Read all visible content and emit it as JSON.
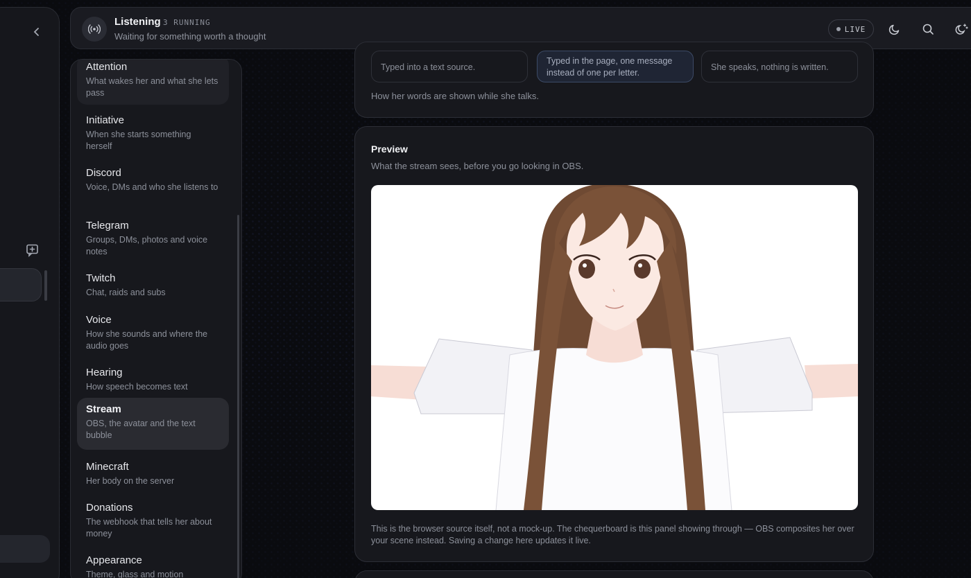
{
  "header": {
    "title": "Listening",
    "running": "3 RUNNING",
    "subtitle": "Waiting for something worth a thought",
    "live_label": "LIVE"
  },
  "sidebar": {
    "items": [
      {
        "title": "Attention",
        "desc": "What wakes her and what she lets pass"
      },
      {
        "title": "Initiative",
        "desc": "When she starts something herself"
      },
      {
        "title": "Discord",
        "desc": "Voice, DMs and who she listens to"
      },
      {
        "title": "Telegram",
        "desc": "Groups, DMs, photos and voice notes"
      },
      {
        "title": "Twitch",
        "desc": "Chat, raids and subs"
      },
      {
        "title": "Voice",
        "desc": "How she sounds and where the audio goes"
      },
      {
        "title": "Hearing",
        "desc": "How speech becomes text"
      },
      {
        "title": "Stream",
        "desc": "OBS, the avatar and the text bubble"
      },
      {
        "title": "Minecraft",
        "desc": "Her body on the server"
      },
      {
        "title": "Donations",
        "desc": "The webhook that tells her about money"
      },
      {
        "title": "Appearance",
        "desc": "Theme, glass and motion"
      }
    ],
    "active_index": 7
  },
  "text_display": {
    "options": [
      {
        "desc": "Typed into a text source."
      },
      {
        "desc": "Typed in the page, one message instead of one per letter."
      },
      {
        "desc": "She speaks, nothing is written."
      }
    ],
    "selected_index": 1,
    "note": "How her words are shown while she talks."
  },
  "preview": {
    "title": "Preview",
    "subtitle": "What the stream sees, before you go looking in OBS.",
    "footnote": "This is the browser source itself, not a mock-up. The chequerboard is this panel showing through — OBS composites her over your scene instead. Saving a change here updates it live."
  },
  "colors": {
    "accent": "#3c4a66",
    "hair": "#7a5238",
    "skin": "#fbe9e2"
  }
}
